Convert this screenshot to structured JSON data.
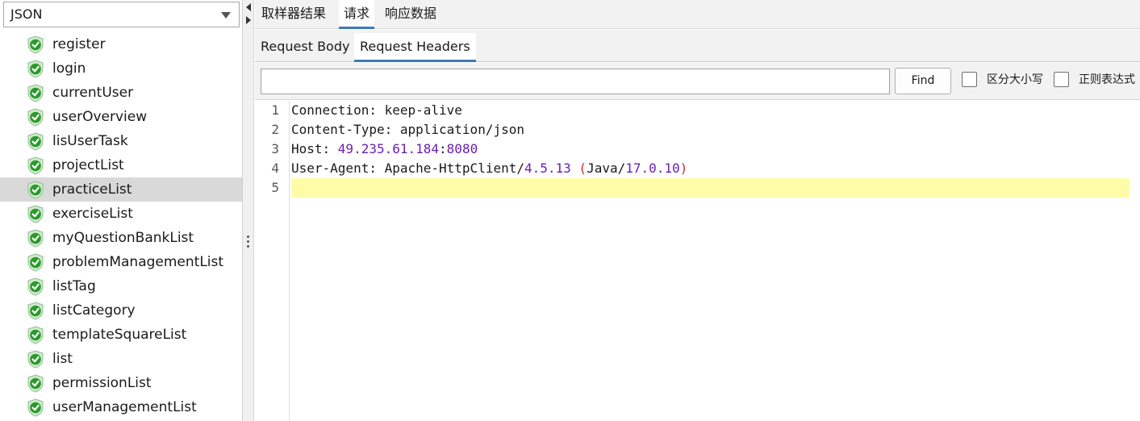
{
  "left_panel": {
    "selector_value": "JSON",
    "samples": [
      {
        "label": "register",
        "selected": false
      },
      {
        "label": "login",
        "selected": false
      },
      {
        "label": "currentUser",
        "selected": false
      },
      {
        "label": "userOverview",
        "selected": false
      },
      {
        "label": "lisUserTask",
        "selected": false
      },
      {
        "label": "projectList",
        "selected": false
      },
      {
        "label": "practiceList",
        "selected": true
      },
      {
        "label": "exerciseList",
        "selected": false
      },
      {
        "label": " myQuestionBankList",
        "selected": false
      },
      {
        "label": "problemManagementList",
        "selected": false
      },
      {
        "label": "listTag",
        "selected": false
      },
      {
        "label": "listCategory",
        "selected": false
      },
      {
        "label": "templateSquareList",
        "selected": false
      },
      {
        "label": "list",
        "selected": false
      },
      {
        "label": "permissionList",
        "selected": false
      },
      {
        "label": "userManagementList",
        "selected": false
      }
    ],
    "status_icon": "green-check-shield-icon"
  },
  "main_tabs": [
    {
      "label": "取样器结果",
      "active": false
    },
    {
      "label": "请求",
      "active": true
    },
    {
      "label": "响应数据",
      "active": false
    }
  ],
  "sub_tabs": [
    {
      "label": "Request Body",
      "active": false
    },
    {
      "label": "Request Headers",
      "active": true
    }
  ],
  "find_bar": {
    "input_value": "",
    "find_label": "Find",
    "case_sensitive_label": "区分大小写",
    "case_sensitive_checked": false,
    "regex_label": "正则表达式",
    "regex_checked": false
  },
  "editor": {
    "line_numbers": [
      "1",
      "2",
      "3",
      "4",
      "5"
    ],
    "lines": [
      "Connection: keep-alive",
      "Content-Type: application/json",
      "Host: 49.235.61.184:8080",
      "User-Agent: Apache-HttpClient/4.5.13 (Java/17.0.10)",
      ""
    ],
    "current_line": 5
  },
  "colors": {
    "accent": "#3d7ab8",
    "selected_row": "#d9d9d9",
    "current_line_highlight": "#fffca8",
    "number_token": "#6a1fb0",
    "paren_token": "#d12a2a",
    "shield_green": "#2a9a2a"
  }
}
